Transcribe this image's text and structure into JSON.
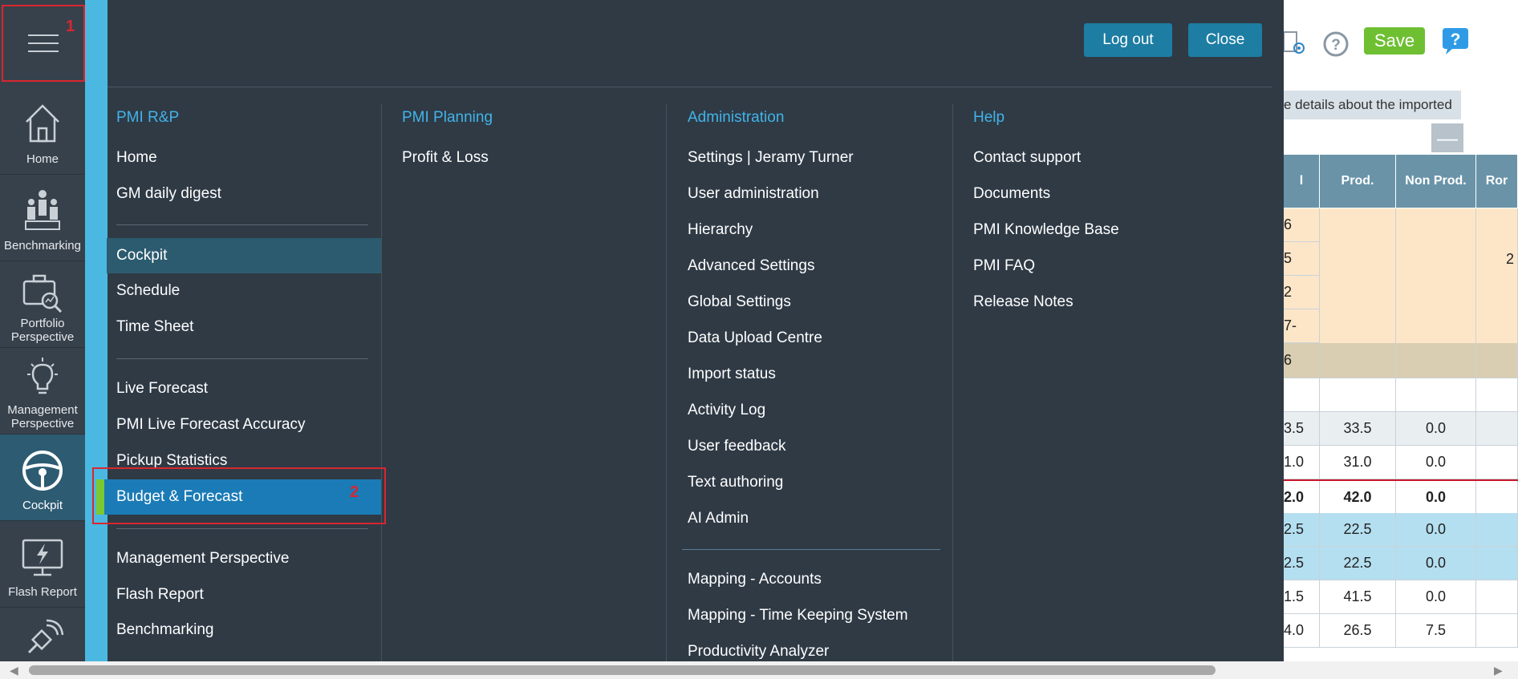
{
  "rail": {
    "toggle_badge": "1",
    "items": [
      {
        "label": "Home",
        "icon": "home-icon"
      },
      {
        "label": "Benchmarking",
        "icon": "people-podium-icon"
      },
      {
        "label": "Portfolio Perspective",
        "icon": "briefcase-chart-icon"
      },
      {
        "label": "Management Perspective",
        "icon": "lightbulb-icon"
      },
      {
        "label": "Cockpit",
        "icon": "steering-wheel-icon"
      },
      {
        "label": "Flash Report",
        "icon": "lightning-monitor-icon"
      },
      {
        "label": "",
        "icon": "satellite-icon"
      }
    ]
  },
  "menu": {
    "logout_label": "Log out",
    "close_label": "Close",
    "selected_badge": "2",
    "columns": [
      {
        "heading": "PMI R&P",
        "items": [
          "Home",
          "GM daily digest",
          "Cockpit",
          "Schedule",
          "Time Sheet",
          "Live Forecast",
          "PMI Live Forecast Accuracy",
          "Pickup Statistics",
          "Budget & Forecast",
          "Management Perspective",
          "Flash Report",
          "Benchmarking"
        ]
      },
      {
        "heading": "PMI Planning",
        "items": [
          "Profit & Loss"
        ]
      },
      {
        "heading": "Administration",
        "items": [
          "Settings | Jeramy Turner",
          "User administration",
          "Hierarchy",
          "Advanced Settings",
          "Global Settings",
          "Data Upload Centre",
          "Import status",
          "Activity Log",
          "User feedback",
          "Text authoring",
          "AI Admin",
          "Mapping - Accounts",
          "Mapping - Time Keeping System",
          "Productivity Analyzer"
        ]
      },
      {
        "heading": "Help",
        "items": [
          "Contact support",
          "Documents",
          "PMI Knowledge Base",
          "PMI FAQ",
          "Release Notes"
        ]
      }
    ]
  },
  "background": {
    "save_label": "Save",
    "info_text": "e details about the imported",
    "minus_label": "—",
    "headers": [
      "l",
      "Prod.",
      "Non Prod.",
      "Ror"
    ],
    "rows": [
      [
        "6",
        "",
        "",
        ""
      ],
      [
        "5",
        "",
        "",
        "2"
      ],
      [
        "2",
        "",
        "",
        ""
      ],
      [
        "7-",
        "",
        "",
        ""
      ],
      [
        "6",
        "",
        "",
        ""
      ],
      [
        "",
        "",
        "",
        ""
      ],
      [
        "3.5",
        "33.5",
        "0.0",
        ""
      ],
      [
        "1.0",
        "31.0",
        "0.0",
        ""
      ],
      [
        "2.0",
        "42.0",
        "0.0",
        ""
      ],
      [
        "2.5",
        "22.5",
        "0.0",
        ""
      ],
      [
        "2.5",
        "22.5",
        "0.0",
        ""
      ],
      [
        "1.5",
        "41.5",
        "0.0",
        ""
      ],
      [
        "4.0",
        "26.5",
        "7.5",
        ""
      ]
    ],
    "colors": {
      "peach": "#fde6c8",
      "tan": "#d9cdb2",
      "lightblue": "#b4dff0",
      "total_line": "#c9162a"
    }
  }
}
